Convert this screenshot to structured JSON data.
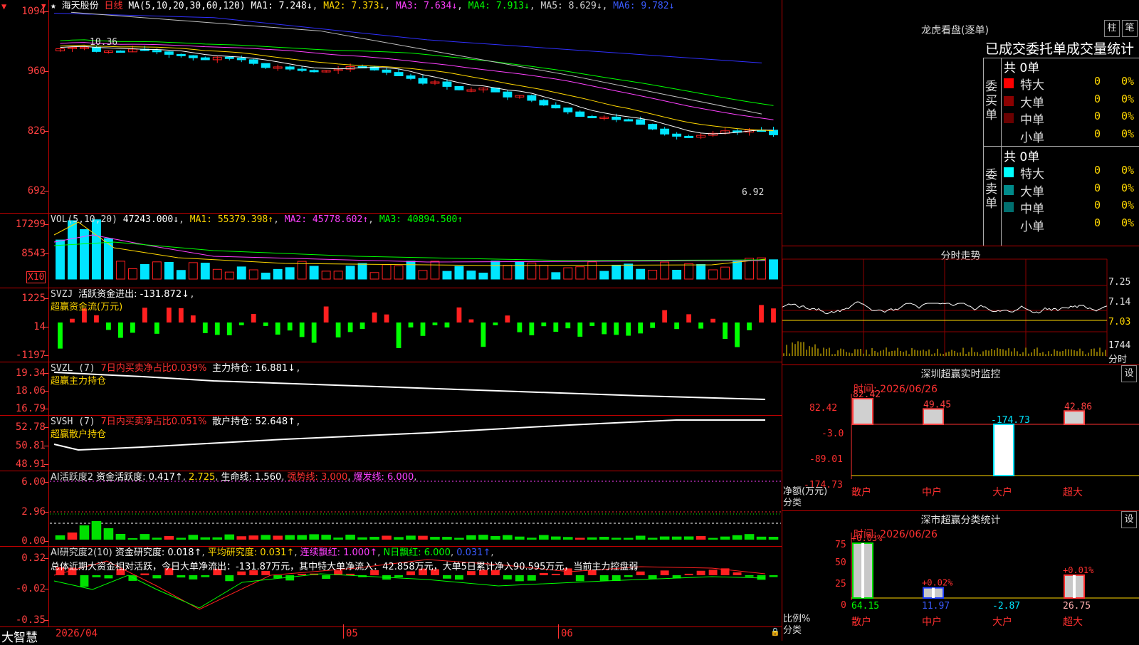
{
  "kline": {
    "star": "★",
    "stock_name": "海天股份",
    "period": "日线",
    "ma_label": "MA(5,10,20,30,60,120)",
    "ma1": "MA1: 7.248↓",
    "ma2": "MA2: 7.373↓",
    "ma3": "MA3: 7.634↓",
    "ma4": "MA4: 7.913↓",
    "ma5": "MA5: 8.629↓",
    "ma6": "MA6: 9.782↓",
    "y_labels": [
      "1094",
      "960",
      "826",
      "692"
    ],
    "high_label": "10.36",
    "low_label": "6.92",
    "colors": {
      "up": "#ff2020",
      "down": "#00e5ff",
      "ma1": "#ffffff",
      "ma2": "#ffd700",
      "ma3": "#ff40ff",
      "ma4": "#00ff00",
      "ma5": "#c0c0c0",
      "ma6": "#3030ff"
    }
  },
  "vol": {
    "title": "VOL(5,10,20)",
    "value": "47243.000↓",
    "ma1": "MA1: 55379.398↑",
    "ma2": "MA2: 45778.602↑",
    "ma3": "MA3: 40894.500↑",
    "y_labels": [
      "17299",
      "8543"
    ],
    "unit": "X10"
  },
  "svzj": {
    "title": "SVZJ",
    "label": "活跃资金进出: -131.872↓",
    "sub": "超赢资金流(万元)",
    "y_labels": [
      "1225",
      "14",
      "-1197"
    ]
  },
  "svzl": {
    "title": "SVZL (7)",
    "label": "7日内买卖净占比0.039%",
    "extra": "主力持仓: 16.881↓",
    "sub": "超赢主力持仓",
    "y_labels": [
      "19.34",
      "18.06",
      "16.79"
    ]
  },
  "svsh": {
    "title": "SVSH (7)",
    "label": "7日内买卖净占比0.051%",
    "extra": "散户持仓: 52.648↑",
    "sub": "超赢散户持仓",
    "y_labels": [
      "52.78",
      "50.81",
      "48.91"
    ]
  },
  "ai2": {
    "title": "AI活跃度2",
    "a": "资金活跃度: 0.417↑",
    "b": "2.725",
    "c": "生命线: 1.560",
    "d": "强势线: 3.000",
    "e": "爆发线: 6.000",
    "y_labels": [
      "6.00",
      "2.96",
      "0.00"
    ]
  },
  "ai_res": {
    "title": "AI研究度2(10)",
    "a": "资金研究度: 0.018↑",
    "b": "平均研究度: 0.031↑",
    "c": "连续飘红: 1.000↑",
    "d": "N日飘红: 6.000",
    "e": "0.031↑",
    "summary": "总体近期大资金相对活跃，今日大单净流出：-131.87万元，其中特大单净流入：42.858万元，大单5日累计净入90.595万元，当前主力控盘弱",
    "y_labels": [
      "0.32",
      "-0.02",
      "-0.35"
    ]
  },
  "bottom": {
    "brand": "大智慧",
    "date": "2026/04",
    "m5": "05",
    "m6": "06"
  },
  "right": {
    "lhk": {
      "title": "龙虎看盘(逐单)",
      "btn1": "柱",
      "btn2": "笔",
      "subtitle": "已成交委托单成交量统计",
      "buy": {
        "side": "委买单",
        "total": "共 0单",
        "rows": [
          {
            "label": "特大",
            "vol": "0",
            "pct": "0%",
            "color": "#ff0000"
          },
          {
            "label": "大单",
            "vol": "0",
            "pct": "0%",
            "color": "#8b0000"
          },
          {
            "label": "中单",
            "vol": "0",
            "pct": "0%",
            "color": "#6a0000"
          },
          {
            "label": "小单",
            "vol": "0",
            "pct": "0%",
            "color": "#000000"
          }
        ]
      },
      "sell": {
        "side": "委卖单",
        "total": "共 0单",
        "rows": [
          {
            "label": "特大",
            "vol": "0",
            "pct": "0%",
            "color": "#00ffff"
          },
          {
            "label": "大单",
            "vol": "0",
            "pct": "0%",
            "color": "#008b8b"
          },
          {
            "label": "中单",
            "vol": "0",
            "pct": "0%",
            "color": "#006f6f"
          },
          {
            "label": "小单",
            "vol": "0",
            "pct": "0%",
            "color": "#000000"
          }
        ]
      }
    },
    "fenshi": {
      "title": "分时走势",
      "y_labels": [
        "7.25",
        "7.14",
        "7.03"
      ],
      "vol_label": "1744",
      "unit": "分时"
    },
    "monitor": {
      "title": "深圳超赢实时监控",
      "btn": "设",
      "time": "时间: 2026/06/26",
      "y_labels": [
        "82.42",
        "-3.0",
        "-89.01",
        "-174.73"
      ],
      "axis_name": "净额(万元)",
      "axis_name2": "分类",
      "cats": [
        "散户",
        "中户",
        "大户",
        "超大"
      ],
      "values": [
        82.42,
        49.45,
        -174.73,
        42.86
      ],
      "value_labels": [
        "82.42",
        "49.45",
        "-174.73",
        "42.86"
      ]
    },
    "classify": {
      "title": "深市超赢分类统计",
      "btn": "设",
      "time": "时间: 2026/06/26",
      "y_labels": [
        "75",
        "50",
        "25",
        "0"
      ],
      "axis_name": "比例%",
      "axis_name2": "分类",
      "cats": [
        "散户",
        "中户",
        "大户",
        "超大"
      ],
      "pct_labels": [
        "+0.03%",
        "+0.02%",
        "",
        "+0.01%"
      ],
      "values": [
        "64.15",
        "11.97",
        "-2.87",
        "26.75"
      ],
      "value_nums": [
        64.15,
        11.97,
        -2.87,
        26.75
      ]
    }
  }
}
